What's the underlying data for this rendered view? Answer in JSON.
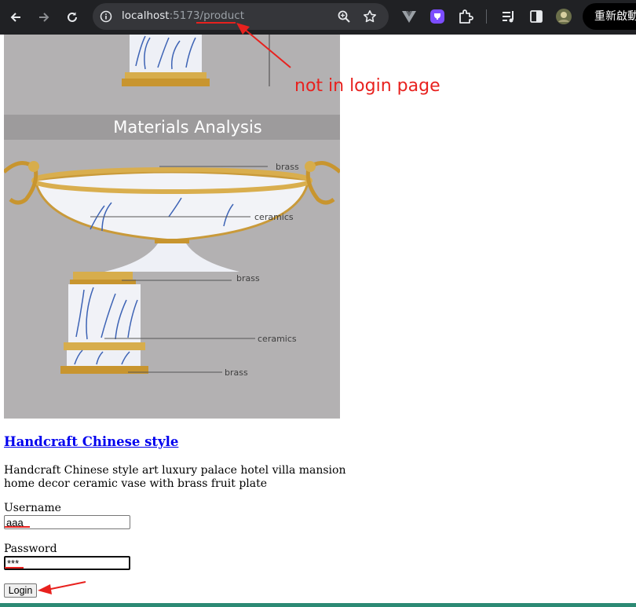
{
  "browser": {
    "url_host": "localhost",
    "url_port": ":5173",
    "url_path": "/product",
    "profile_label": "重新啟動"
  },
  "product": {
    "image": {
      "heading": "Materials Analysis",
      "labels": [
        "brass",
        "ceramics",
        "brass",
        "ceramics",
        "brass"
      ]
    },
    "title": "Handcraft Chinese style",
    "description": "Handcraft Chinese style art luxury palace hotel villa mansion home decor ceramic vase with brass fruit plate"
  },
  "login_form": {
    "username_label": "Username",
    "username_value": "aaa",
    "password_label": "Password",
    "password_value": "***",
    "login_button": "Login"
  },
  "annotation": {
    "note": "not in login page",
    "color": "#e8211e"
  },
  "colors": {
    "chrome_bg": "#202124",
    "omnibox_bg": "#35363a",
    "link": "#0000ee",
    "image_bg": "#b3b1b2"
  },
  "icons": [
    "back-arrow-icon",
    "forward-arrow-icon",
    "reload-icon",
    "site-info-icon",
    "zoom-icon",
    "bookmark-star-icon",
    "vue-devtools-icon",
    "extension-purple-icon",
    "extensions-puzzle-icon",
    "media-control-icon",
    "side-panel-icon",
    "profile-avatar-icon"
  ]
}
